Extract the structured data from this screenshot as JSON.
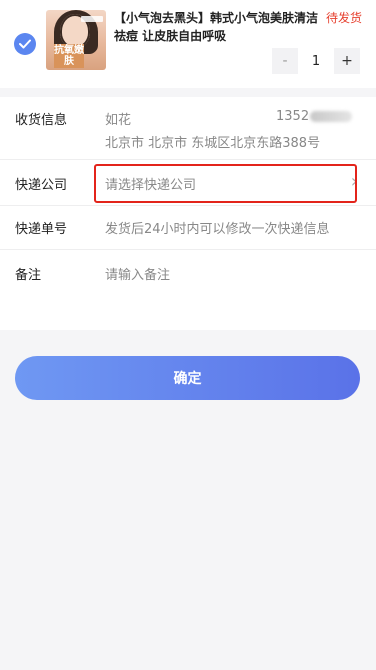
{
  "product": {
    "title": "【小气泡去黑头】韩式小气泡美肤清洁祛痘 让皮肤自由呼吸",
    "status": "待发货",
    "image_tag": "抗氧嫩肤",
    "quantity": "1",
    "minus_label": "-",
    "plus_label": "+"
  },
  "form": {
    "receiver": {
      "label": "收货信息",
      "name": "如花",
      "phone_visible": "1352",
      "address": "北京市 北京市 东城区北京东路388号"
    },
    "courier": {
      "label": "快递公司",
      "placeholder": "请选择快递公司",
      "chevron": "›"
    },
    "tracking": {
      "label": "快递单号",
      "hint": "发货后24小时内可以修改一次快递信息"
    },
    "remark": {
      "label": "备注",
      "placeholder": "请输入备注"
    }
  },
  "confirm_label": "确定",
  "colors": {
    "accent": "#5b86f0",
    "status": "#e6402f",
    "highlight": "#e3241b"
  }
}
